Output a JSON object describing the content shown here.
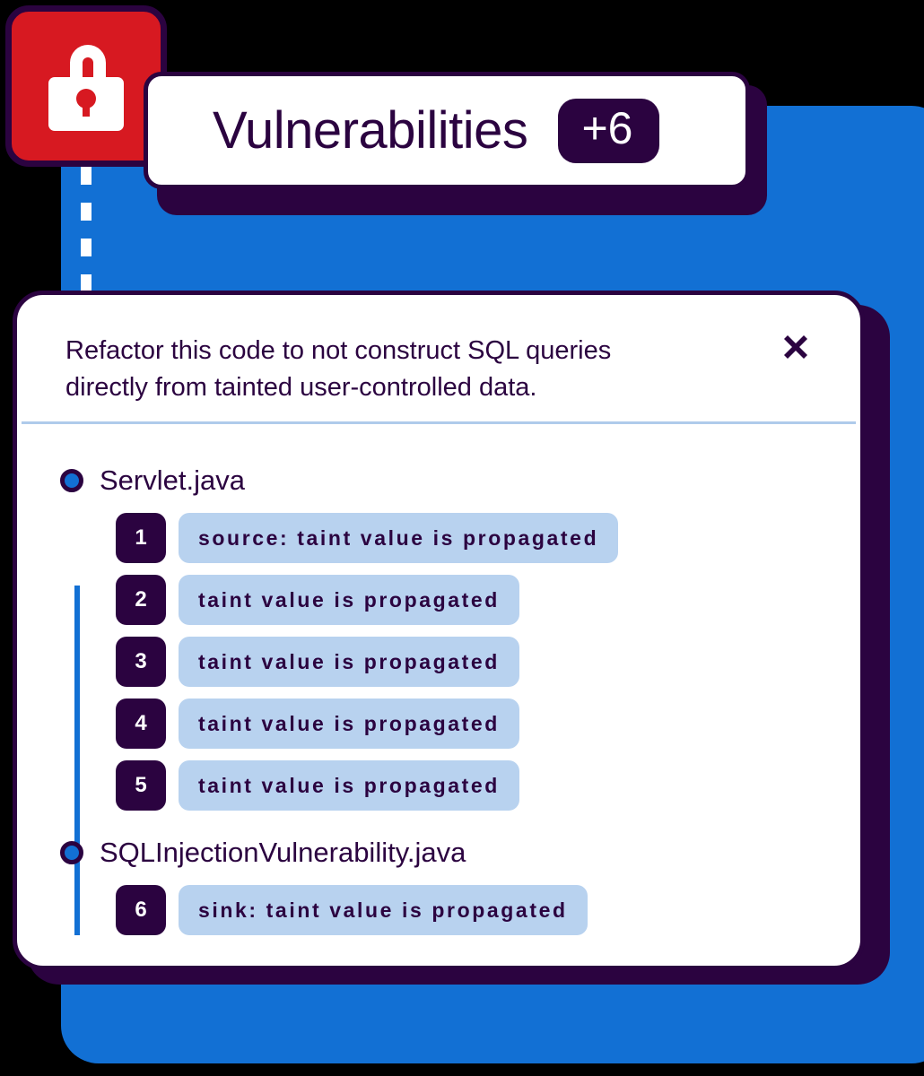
{
  "colors": {
    "blue_panel": "#1270D4",
    "dark_purple": "#2B0340",
    "alert_red": "#D71921",
    "chip_blue": "#B8D2EF",
    "divider_blue": "#AFCBEB"
  },
  "header": {
    "icon": "open-padlock-icon",
    "title": "Vulnerabilities",
    "badge": "+6"
  },
  "card": {
    "description": "Refactor this code to not construct SQL queries directly from tainted user-controlled data.",
    "close_label": "✕",
    "groups": [
      {
        "file": "Servlet.java",
        "steps": [
          {
            "num": "1",
            "text": "source: taint value is propagated"
          },
          {
            "num": "2",
            "text": "taint value is propagated"
          },
          {
            "num": "3",
            "text": "taint value is propagated"
          },
          {
            "num": "4",
            "text": "taint value is propagated"
          },
          {
            "num": "5",
            "text": "taint value is propagated"
          }
        ]
      },
      {
        "file": "SQLInjectionVulnerability.java",
        "steps": [
          {
            "num": "6",
            "text": "sink: taint value is propagated"
          }
        ]
      }
    ]
  }
}
